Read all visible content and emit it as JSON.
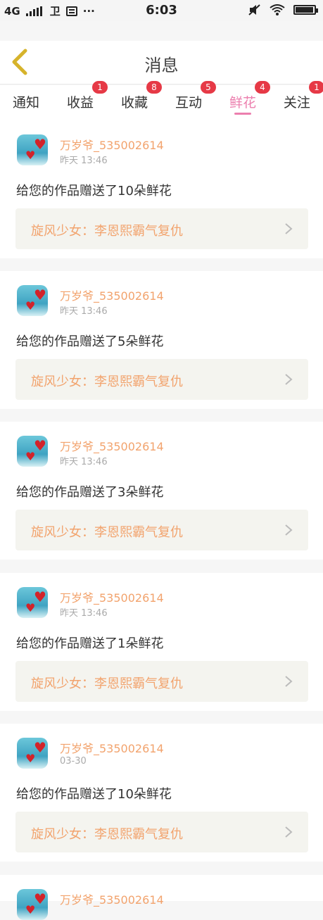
{
  "statusbar": {
    "network": "4G",
    "sim_label": "卫",
    "dots": "···",
    "time": "6:03",
    "battery_level": 0.9
  },
  "header": {
    "title": "消息"
  },
  "tabs": [
    {
      "label": "通知",
      "badge": ""
    },
    {
      "label": "收益",
      "badge": "1"
    },
    {
      "label": "收藏",
      "badge": "8"
    },
    {
      "label": "互动",
      "badge": "5"
    },
    {
      "label": "鲜花",
      "badge": "4"
    },
    {
      "label": "关注",
      "badge": "1"
    }
  ],
  "active_tab": "鲜花",
  "messages": [
    {
      "user": "万岁爷_535002614",
      "time": "昨天 13:46",
      "text": "给您的作品赠送了10朵鲜花",
      "work": "旋风少女：李恩熙霸气复仇"
    },
    {
      "user": "万岁爷_535002614",
      "time": "昨天 13:46",
      "text": "给您的作品赠送了5朵鲜花",
      "work": "旋风少女：李恩熙霸气复仇"
    },
    {
      "user": "万岁爷_535002614",
      "time": "昨天 13:46",
      "text": "给您的作品赠送了3朵鲜花",
      "work": "旋风少女：李恩熙霸气复仇"
    },
    {
      "user": "万岁爷_535002614",
      "time": "昨天 13:46",
      "text": "给您的作品赠送了1朵鲜花",
      "work": "旋风少女：李恩熙霸气复仇"
    },
    {
      "user": "万岁爷_535002614",
      "time": "03-30",
      "text": "给您的作品赠送了10朵鲜花",
      "work": "旋风少女：李恩熙霸气复仇"
    },
    {
      "user": "万岁爷_535002614",
      "time": "",
      "text": "",
      "work": ""
    }
  ],
  "colors": {
    "accent": "#ec7fae",
    "username": "#f2a36d",
    "badge": "#e63946"
  }
}
